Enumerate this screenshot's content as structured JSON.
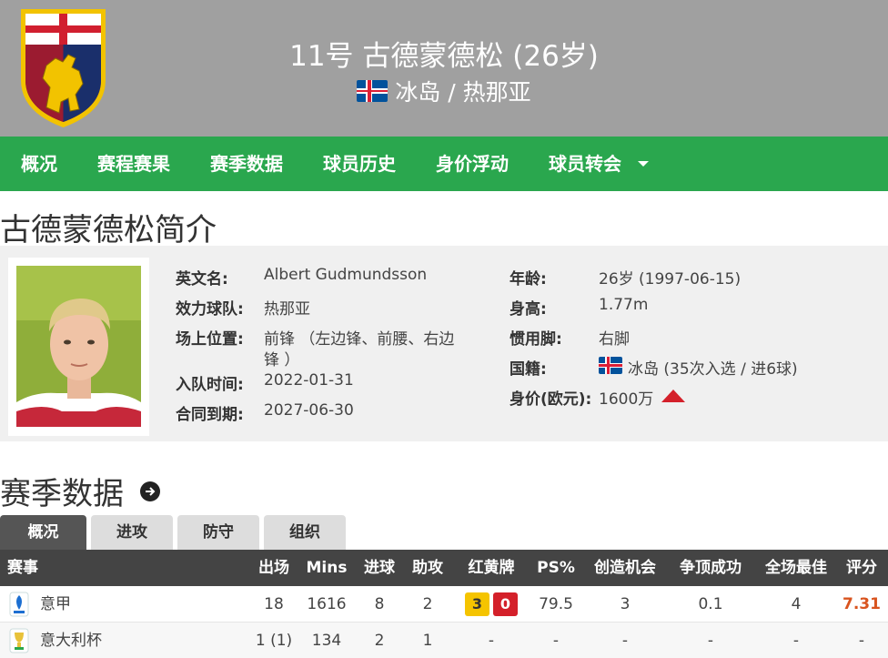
{
  "header": {
    "title": "11号 古德蒙德松 (26岁)",
    "subtitle": "冰岛 / 热那亚",
    "bg_color": "#a0a0a0"
  },
  "nav": {
    "items": [
      "概况",
      "赛程赛果",
      "赛季数据",
      "球员历史",
      "身价浮动",
      "球员转会"
    ],
    "color": "#2aa74e"
  },
  "intro": {
    "title": "古德蒙德松简介",
    "left": [
      {
        "label": "英文名:",
        "value": "Albert Gudmundsson"
      },
      {
        "label": "效力球队:",
        "value": "热那亚"
      },
      {
        "label": "场上位置:",
        "value": "前锋 （左边锋、前腰、右边",
        "value2": "锋 ）"
      },
      {
        "label": "入队时间:",
        "value": "2022-01-31"
      },
      {
        "label": "合同到期:",
        "value": "2027-06-30"
      }
    ],
    "right": [
      {
        "label": "年龄:",
        "value": "26岁  (1997-06-15)"
      },
      {
        "label": "身高:",
        "value": "1.77m"
      },
      {
        "label": "惯用脚:",
        "value": "右脚"
      },
      {
        "label": "国籍:",
        "value": "冰岛 (35次入选 / 进6球)"
      },
      {
        "label": "身价(欧元):",
        "value": "1600万"
      }
    ]
  },
  "season": {
    "title": "赛季数据",
    "tabs": [
      "概况",
      "进攻",
      "防守",
      "组织"
    ],
    "active_tab": 0,
    "columns": [
      "赛事",
      "出场",
      "Mins",
      "进球",
      "助攻",
      "红黄牌",
      "PS%",
      "创造机会",
      "争顶成功",
      "全场最佳",
      "评分"
    ],
    "rows": [
      {
        "comp": "意甲",
        "apps": "18",
        "mins": "1616",
        "goals": "8",
        "assists": "2",
        "yellow": "3",
        "red": "0",
        "ps": "79.5",
        "chances": "3",
        "aerial": "0.1",
        "motm": "4",
        "rating": "7.31"
      },
      {
        "comp": "意大利杯",
        "apps": "1 (1)",
        "mins": "134",
        "goals": "2",
        "assists": "1",
        "cards": "-",
        "ps": "-",
        "chances": "-",
        "aerial": "-",
        "motm": "-",
        "rating": "-"
      }
    ]
  },
  "colors": {
    "rating": "#d9541f",
    "yellow_card": "#f5c400",
    "red_card": "#d4202a",
    "table_header": "#444444"
  }
}
